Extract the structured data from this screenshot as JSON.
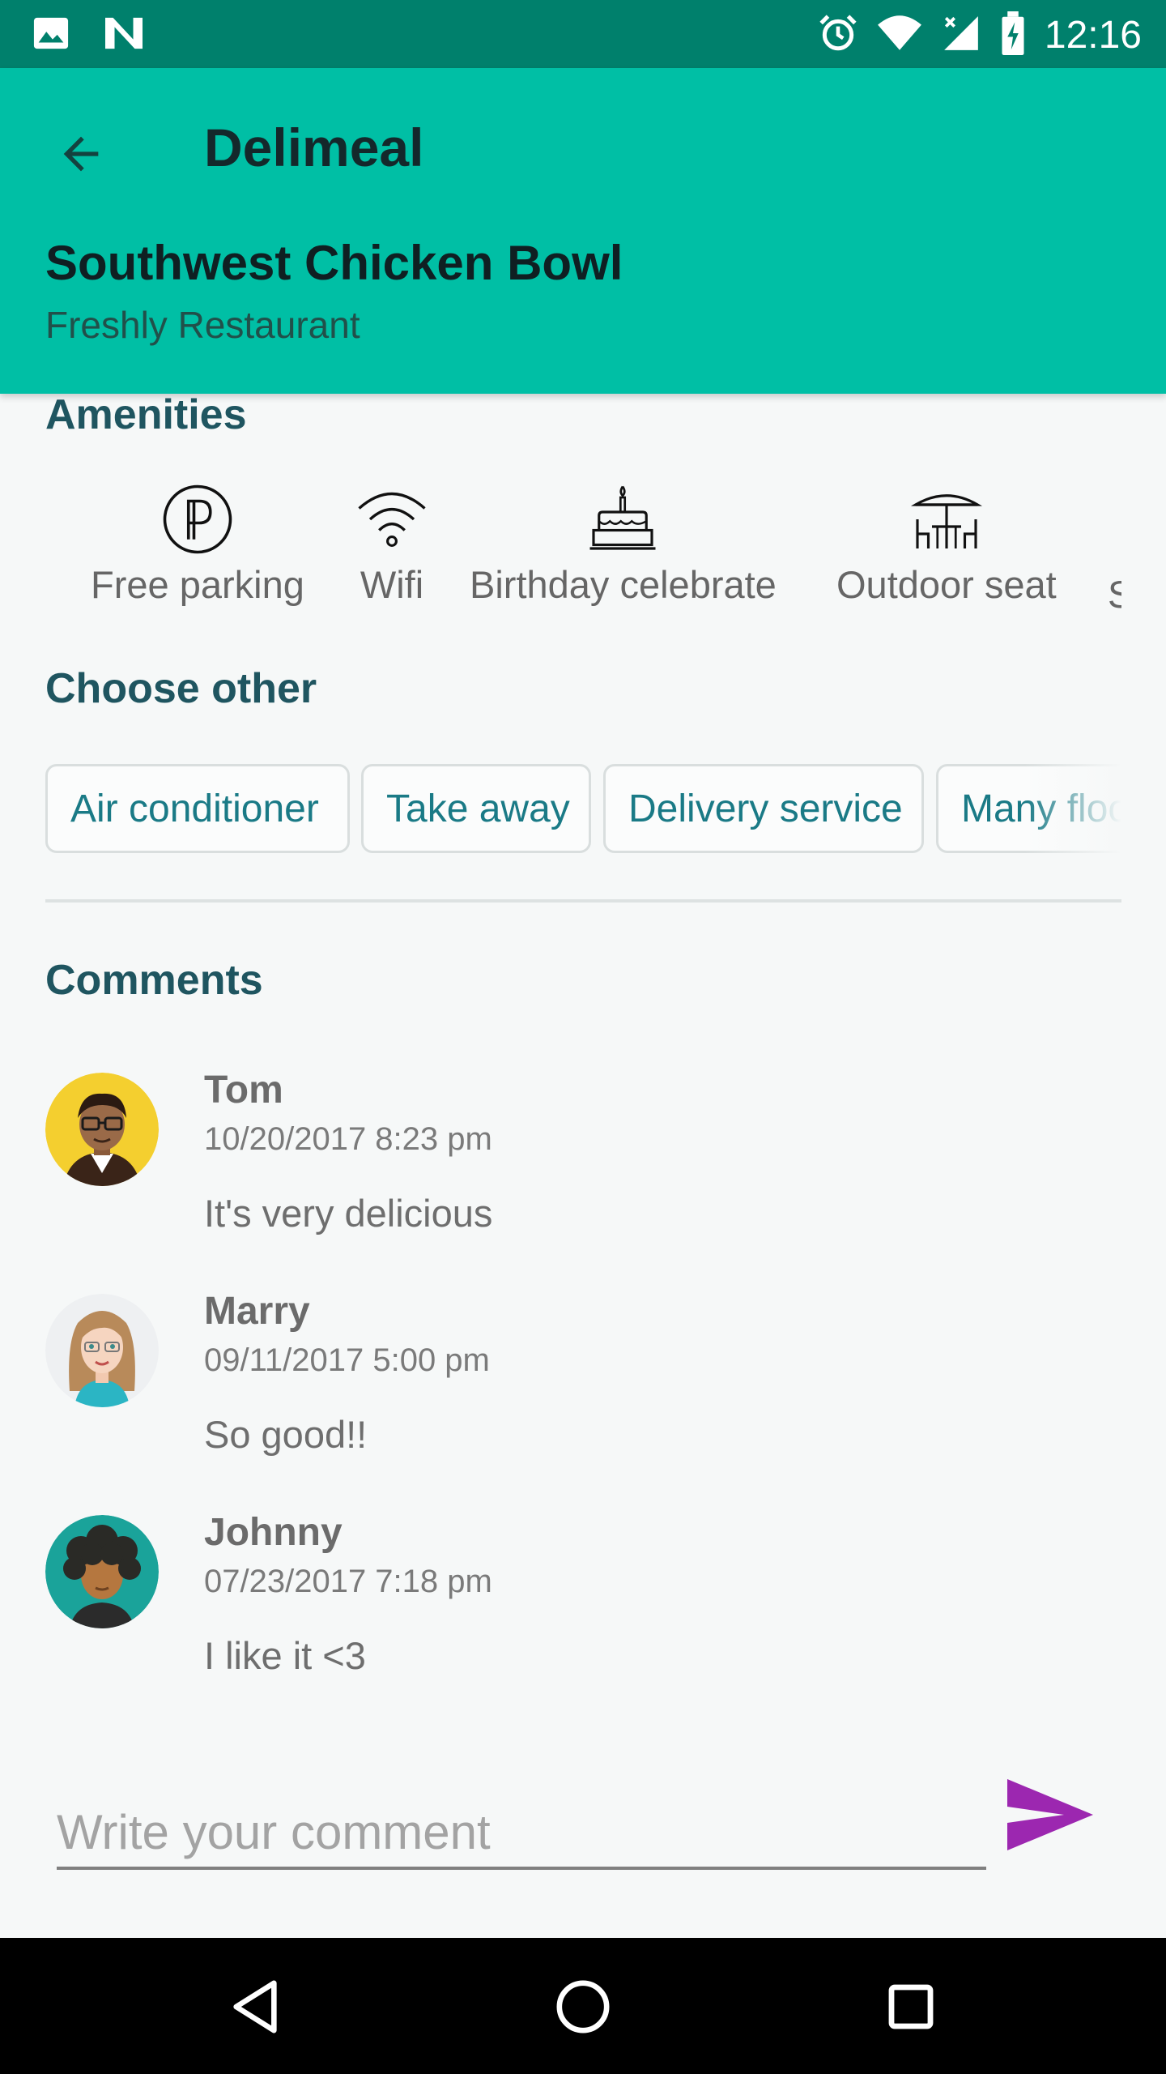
{
  "status_bar": {
    "time": "12:16"
  },
  "appbar": {
    "title": "Delimeal",
    "dish_name": "Southwest Chicken Bowl",
    "restaurant": "Freshly Restaurant"
  },
  "amenities": {
    "heading": "Amenities",
    "items": [
      {
        "label": "Free parking",
        "icon": "parking-icon"
      },
      {
        "label": "Wifi",
        "icon": "wifi-icon"
      },
      {
        "label": "Birthday celebrate",
        "icon": "cake-icon"
      },
      {
        "label": "Outdoor seat",
        "icon": "outdoor-table-icon"
      },
      {
        "label": "S",
        "icon": ""
      }
    ]
  },
  "choose_other": {
    "heading": "Choose other",
    "chips": [
      "Air conditioner",
      "Take away",
      "Delivery service",
      "Many floors"
    ]
  },
  "comments": {
    "heading": "Comments",
    "items": [
      {
        "name": "Tom",
        "date": "10/20/2017 8:23 pm",
        "text": "It's very delicious"
      },
      {
        "name": "Marry",
        "date": "09/11/2017 5:00 pm",
        "text": "So good!!"
      },
      {
        "name": "Johnny",
        "date": "07/23/2017 7:18 pm",
        "text": "I like it <3"
      }
    ]
  },
  "comment_input": {
    "placeholder": "Write your comment",
    "value": ""
  },
  "colors": {
    "appbar": "#00bfa5",
    "status_bar": "#00806c",
    "send": "#9c27b0",
    "heading": "#1f5560"
  }
}
